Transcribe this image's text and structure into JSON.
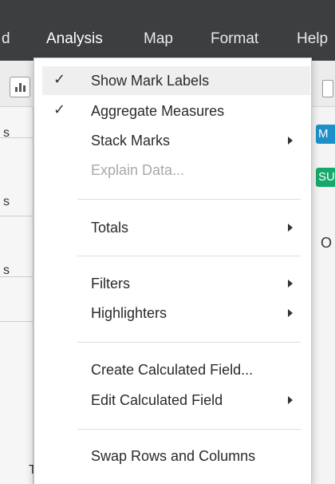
{
  "menubar": {
    "items": [
      {
        "label": "d"
      },
      {
        "label": "Analysis"
      },
      {
        "label": "Map"
      },
      {
        "label": "Format"
      },
      {
        "label": "Help"
      }
    ]
  },
  "background": {
    "left_fragments": [
      "s",
      "s",
      "s"
    ],
    "right_pills": [
      {
        "text": "M",
        "color": "#1f8fc9"
      },
      {
        "text": "SU",
        "color": "#17a96b"
      }
    ],
    "right_fragment": "O",
    "bottom_fragment": "T"
  },
  "menu": {
    "items": [
      {
        "label": "Show Mark Labels",
        "checked": true,
        "submenu": false,
        "disabled": false,
        "highlighted": true
      },
      {
        "label": "Aggregate Measures",
        "checked": true,
        "submenu": false,
        "disabled": false
      },
      {
        "label": "Stack Marks",
        "checked": false,
        "submenu": true,
        "disabled": false
      },
      {
        "label": "Explain Data...",
        "checked": false,
        "submenu": false,
        "disabled": true
      },
      {
        "label": "Totals",
        "checked": false,
        "submenu": true,
        "disabled": false
      },
      {
        "label": "Filters",
        "checked": false,
        "submenu": true,
        "disabled": false
      },
      {
        "label": "Highlighters",
        "checked": false,
        "submenu": true,
        "disabled": false
      },
      {
        "label": "Create Calculated Field...",
        "checked": false,
        "submenu": false,
        "disabled": false
      },
      {
        "label": "Edit Calculated Field",
        "checked": false,
        "submenu": true,
        "disabled": false
      },
      {
        "label": "Swap Rows and Columns",
        "checked": false,
        "submenu": false,
        "disabled": false
      }
    ],
    "check_glyph": "✓"
  }
}
